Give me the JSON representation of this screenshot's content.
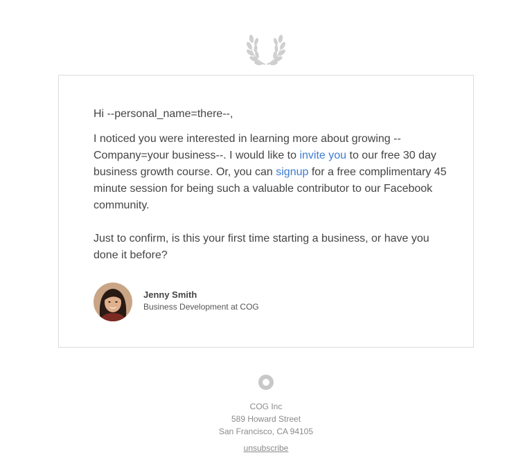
{
  "email": {
    "greeting": "Hi --personal_name=there--,",
    "paragraph1": {
      "part1": "I noticed you were interested in learning more about growing --Company=your business--. I would like to ",
      "link1": "invite you",
      "part2": " to our free 30 day business growth course. Or, you can ",
      "link2": "signup",
      "part3": " for a free complimentary 45 minute session for being such a valuable contributor to our Facebook community."
    },
    "paragraph2": "Just to confirm, is this your first time starting a business, or have you done it before?",
    "signature": {
      "name": "Jenny Smith",
      "title": "Business Development at COG"
    }
  },
  "footer": {
    "company": "COG Inc",
    "street": "589 Howard Street",
    "city": "San Francisco, CA 94105",
    "unsubscribe": "unsubscribe"
  },
  "colors": {
    "link": "#3d7bd0",
    "text": "#444444",
    "footer_text": "#8a8a8a",
    "card_border": "#dcdcdc"
  },
  "icons": {
    "top_logo": "laurel-wreath-icon",
    "footer_logo": "ring-icon"
  }
}
